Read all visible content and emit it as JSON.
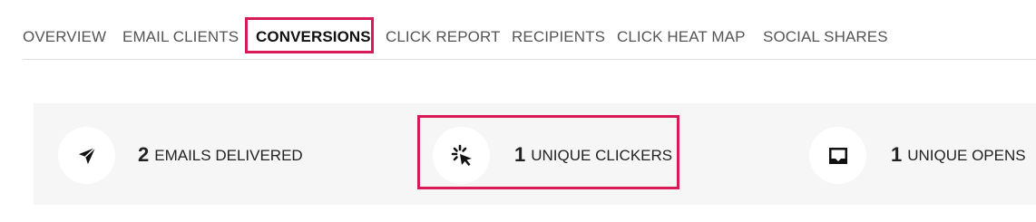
{
  "tabs": [
    {
      "label": "OVERVIEW",
      "active": false
    },
    {
      "label": "EMAIL CLIENTS",
      "active": false
    },
    {
      "label": "CONVERSIONS",
      "active": true
    },
    {
      "label": "CLICK REPORT",
      "active": false
    },
    {
      "label": "RECIPIENTS",
      "active": false
    },
    {
      "label": "CLICK HEAT MAP",
      "active": false
    },
    {
      "label": "SOCIAL SHARES",
      "active": false
    }
  ],
  "stats": [
    {
      "value": "2",
      "label": "EMAILS DELIVERED",
      "icon": "paper-plane-icon"
    },
    {
      "value": "1",
      "label": "UNIQUE CLICKERS",
      "icon": "click-cursor-icon"
    },
    {
      "value": "1",
      "label": "UNIQUE OPENS",
      "icon": "inbox-icon"
    }
  ],
  "colors": {
    "highlight": "#d81b57",
    "panel_background": "#f6f6f6",
    "tab_text": "#555555"
  }
}
